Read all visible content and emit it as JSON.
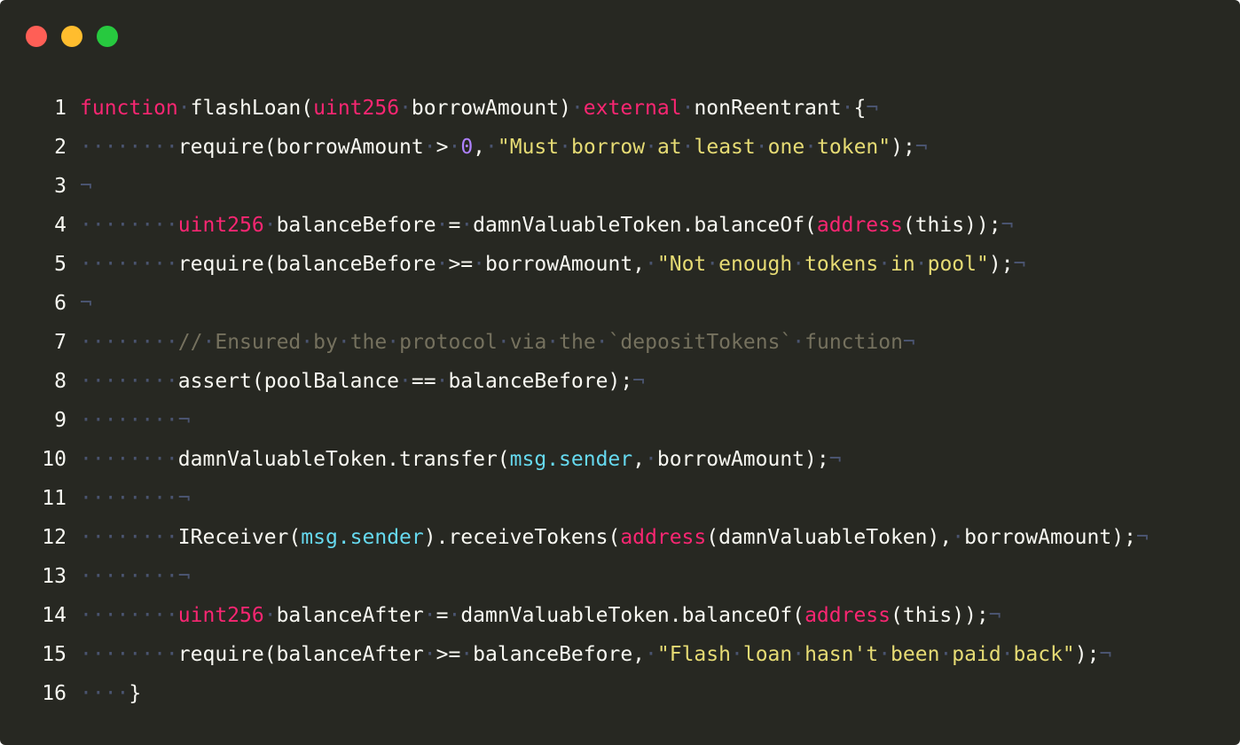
{
  "window": {
    "colors": {
      "background": "#272822",
      "close": "#ff5f56",
      "minimize": "#ffbd2e",
      "maximize": "#27c93f"
    }
  },
  "code": {
    "language": "solidity",
    "theme": {
      "keyword": "#f92672",
      "string": "#e6db74",
      "number": "#ae81ff",
      "comment": "#75715e",
      "builtin": "#66d9ef",
      "invisibles": "#4a5470",
      "plain": "#f8f8f2"
    },
    "lines": [
      {
        "number": "1",
        "tokens": [
          {
            "t": "function",
            "c": "kw"
          },
          {
            "t": "·",
            "c": "ws"
          },
          {
            "t": "flashLoan(",
            "c": "pl"
          },
          {
            "t": "uint256",
            "c": "kw"
          },
          {
            "t": "·",
            "c": "ws"
          },
          {
            "t": "borrowAmount)",
            "c": "pl"
          },
          {
            "t": "·",
            "c": "ws"
          },
          {
            "t": "external",
            "c": "kw"
          },
          {
            "t": "·",
            "c": "ws"
          },
          {
            "t": "nonReentrant",
            "c": "pl"
          },
          {
            "t": "·",
            "c": "ws"
          },
          {
            "t": "{",
            "c": "pl"
          },
          {
            "t": "¬",
            "c": "eol"
          }
        ]
      },
      {
        "number": "2",
        "tokens": [
          {
            "t": "········",
            "c": "ws"
          },
          {
            "t": "require(borrowAmount",
            "c": "pl"
          },
          {
            "t": "·",
            "c": "ws"
          },
          {
            "t": ">",
            "c": "pl"
          },
          {
            "t": "·",
            "c": "ws"
          },
          {
            "t": "0",
            "c": "num"
          },
          {
            "t": ",",
            "c": "pl"
          },
          {
            "t": "·",
            "c": "ws"
          },
          {
            "t": "\"Must",
            "c": "str"
          },
          {
            "t": "·",
            "c": "ws"
          },
          {
            "t": "borrow",
            "c": "str"
          },
          {
            "t": "·",
            "c": "ws"
          },
          {
            "t": "at",
            "c": "str"
          },
          {
            "t": "·",
            "c": "ws"
          },
          {
            "t": "least",
            "c": "str"
          },
          {
            "t": "·",
            "c": "ws"
          },
          {
            "t": "one",
            "c": "str"
          },
          {
            "t": "·",
            "c": "ws"
          },
          {
            "t": "token\"",
            "c": "str"
          },
          {
            "t": ");",
            "c": "pl"
          },
          {
            "t": "¬",
            "c": "eol"
          }
        ]
      },
      {
        "number": "3",
        "tokens": [
          {
            "t": "¬",
            "c": "eol"
          }
        ]
      },
      {
        "number": "4",
        "tokens": [
          {
            "t": "········",
            "c": "ws"
          },
          {
            "t": "uint256",
            "c": "kw"
          },
          {
            "t": "·",
            "c": "ws"
          },
          {
            "t": "balanceBefore",
            "c": "pl"
          },
          {
            "t": "·",
            "c": "ws"
          },
          {
            "t": "=",
            "c": "pl"
          },
          {
            "t": "·",
            "c": "ws"
          },
          {
            "t": "damnValuableToken.balanceOf(",
            "c": "pl"
          },
          {
            "t": "address",
            "c": "kw"
          },
          {
            "t": "(this));",
            "c": "pl"
          },
          {
            "t": "¬",
            "c": "eol"
          }
        ]
      },
      {
        "number": "5",
        "tokens": [
          {
            "t": "········",
            "c": "ws"
          },
          {
            "t": "require(balanceBefore",
            "c": "pl"
          },
          {
            "t": "·",
            "c": "ws"
          },
          {
            "t": ">=",
            "c": "pl"
          },
          {
            "t": "·",
            "c": "ws"
          },
          {
            "t": "borrowAmount,",
            "c": "pl"
          },
          {
            "t": "·",
            "c": "ws"
          },
          {
            "t": "\"Not",
            "c": "str"
          },
          {
            "t": "·",
            "c": "ws"
          },
          {
            "t": "enough",
            "c": "str"
          },
          {
            "t": "·",
            "c": "ws"
          },
          {
            "t": "tokens",
            "c": "str"
          },
          {
            "t": "·",
            "c": "ws"
          },
          {
            "t": "in",
            "c": "str"
          },
          {
            "t": "·",
            "c": "ws"
          },
          {
            "t": "pool\"",
            "c": "str"
          },
          {
            "t": ");",
            "c": "pl"
          },
          {
            "t": "¬",
            "c": "eol"
          }
        ]
      },
      {
        "number": "6",
        "tokens": [
          {
            "t": "¬",
            "c": "eol"
          }
        ]
      },
      {
        "number": "7",
        "tokens": [
          {
            "t": "········",
            "c": "ws"
          },
          {
            "t": "//",
            "c": "cm"
          },
          {
            "t": "·",
            "c": "ws"
          },
          {
            "t": "Ensured",
            "c": "cm"
          },
          {
            "t": "·",
            "c": "ws"
          },
          {
            "t": "by",
            "c": "cm"
          },
          {
            "t": "·",
            "c": "ws"
          },
          {
            "t": "the",
            "c": "cm"
          },
          {
            "t": "·",
            "c": "ws"
          },
          {
            "t": "protocol",
            "c": "cm"
          },
          {
            "t": "·",
            "c": "ws"
          },
          {
            "t": "via",
            "c": "cm"
          },
          {
            "t": "·",
            "c": "ws"
          },
          {
            "t": "the",
            "c": "cm"
          },
          {
            "t": "·",
            "c": "ws"
          },
          {
            "t": "`depositTokens`",
            "c": "cm"
          },
          {
            "t": "·",
            "c": "ws"
          },
          {
            "t": "function",
            "c": "cm"
          },
          {
            "t": "¬",
            "c": "eol"
          }
        ]
      },
      {
        "number": "8",
        "tokens": [
          {
            "t": "········",
            "c": "ws"
          },
          {
            "t": "assert(poolBalance",
            "c": "pl"
          },
          {
            "t": "·",
            "c": "ws"
          },
          {
            "t": "==",
            "c": "pl"
          },
          {
            "t": "·",
            "c": "ws"
          },
          {
            "t": "balanceBefore);",
            "c": "pl"
          },
          {
            "t": "¬",
            "c": "eol"
          }
        ]
      },
      {
        "number": "9",
        "tokens": [
          {
            "t": "········",
            "c": "ws"
          },
          {
            "t": "¬",
            "c": "eol"
          }
        ]
      },
      {
        "number": "10",
        "tokens": [
          {
            "t": "········",
            "c": "ws"
          },
          {
            "t": "damnValuableToken.transfer(",
            "c": "pl"
          },
          {
            "t": "msg.sender",
            "c": "msg"
          },
          {
            "t": ",",
            "c": "pl"
          },
          {
            "t": "·",
            "c": "ws"
          },
          {
            "t": "borrowAmount);",
            "c": "pl"
          },
          {
            "t": "¬",
            "c": "eol"
          }
        ]
      },
      {
        "number": "11",
        "tokens": [
          {
            "t": "········",
            "c": "ws"
          },
          {
            "t": "¬",
            "c": "eol"
          }
        ]
      },
      {
        "number": "12",
        "tokens": [
          {
            "t": "········",
            "c": "ws"
          },
          {
            "t": "IReceiver(",
            "c": "pl"
          },
          {
            "t": "msg.sender",
            "c": "msg"
          },
          {
            "t": ").receiveTokens(",
            "c": "pl"
          },
          {
            "t": "address",
            "c": "kw"
          },
          {
            "t": "(damnValuableToken),",
            "c": "pl"
          },
          {
            "t": "·",
            "c": "ws"
          },
          {
            "t": "borrowAmount);",
            "c": "pl"
          },
          {
            "t": "¬",
            "c": "eol"
          }
        ]
      },
      {
        "number": "13",
        "tokens": [
          {
            "t": "········",
            "c": "ws"
          },
          {
            "t": "¬",
            "c": "eol"
          }
        ]
      },
      {
        "number": "14",
        "tokens": [
          {
            "t": "········",
            "c": "ws"
          },
          {
            "t": "uint256",
            "c": "kw"
          },
          {
            "t": "·",
            "c": "ws"
          },
          {
            "t": "balanceAfter",
            "c": "pl"
          },
          {
            "t": "·",
            "c": "ws"
          },
          {
            "t": "=",
            "c": "pl"
          },
          {
            "t": "·",
            "c": "ws"
          },
          {
            "t": "damnValuableToken.balanceOf(",
            "c": "pl"
          },
          {
            "t": "address",
            "c": "kw"
          },
          {
            "t": "(this));",
            "c": "pl"
          },
          {
            "t": "¬",
            "c": "eol"
          }
        ]
      },
      {
        "number": "15",
        "tokens": [
          {
            "t": "········",
            "c": "ws"
          },
          {
            "t": "require(balanceAfter",
            "c": "pl"
          },
          {
            "t": "·",
            "c": "ws"
          },
          {
            "t": ">=",
            "c": "pl"
          },
          {
            "t": "·",
            "c": "ws"
          },
          {
            "t": "balanceBefore,",
            "c": "pl"
          },
          {
            "t": "·",
            "c": "ws"
          },
          {
            "t": "\"Flash",
            "c": "str"
          },
          {
            "t": "·",
            "c": "ws"
          },
          {
            "t": "loan",
            "c": "str"
          },
          {
            "t": "·",
            "c": "ws"
          },
          {
            "t": "hasn't",
            "c": "str"
          },
          {
            "t": "·",
            "c": "ws"
          },
          {
            "t": "been",
            "c": "str"
          },
          {
            "t": "·",
            "c": "ws"
          },
          {
            "t": "paid",
            "c": "str"
          },
          {
            "t": "·",
            "c": "ws"
          },
          {
            "t": "back\"",
            "c": "str"
          },
          {
            "t": ");",
            "c": "pl"
          },
          {
            "t": "¬",
            "c": "eol"
          }
        ]
      },
      {
        "number": "16",
        "tokens": [
          {
            "t": "····",
            "c": "ws"
          },
          {
            "t": "}",
            "c": "pl"
          }
        ]
      }
    ]
  }
}
